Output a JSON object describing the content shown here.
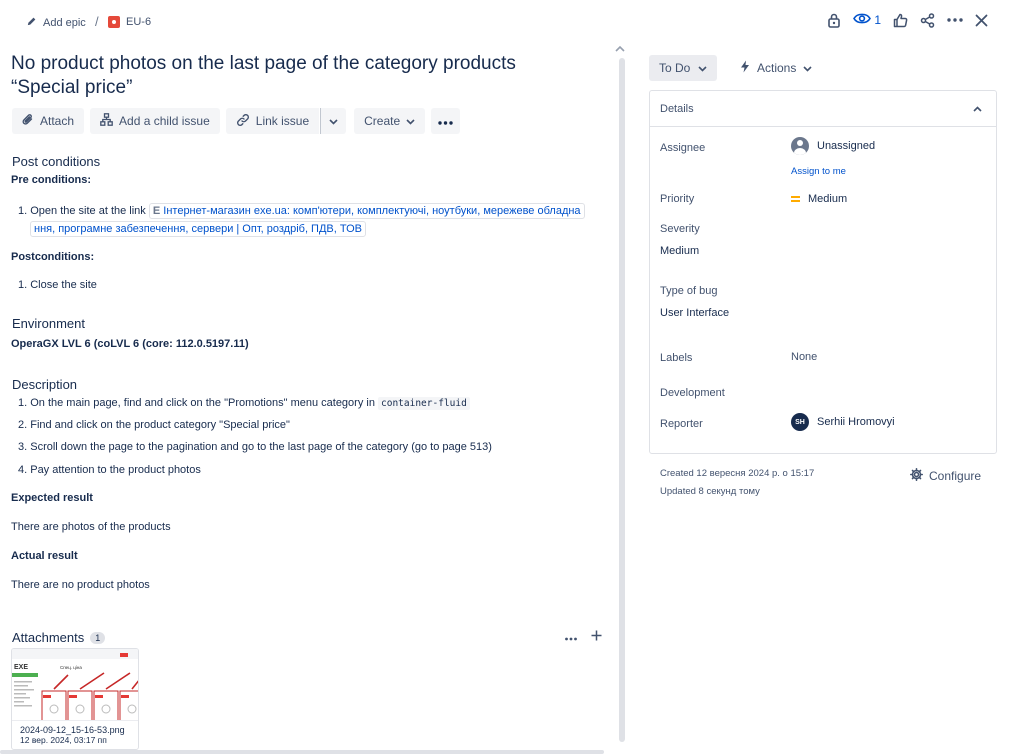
{
  "breadcrumb": {
    "add_epic": "Add epic",
    "separator": "/",
    "issue_key": "EU-6"
  },
  "header": {
    "watchers_count": "1"
  },
  "issue": {
    "title": "No product photos on the last page of the category products “Special price”"
  },
  "toolbar": {
    "attach": "Attach",
    "add_child": "Add a child issue",
    "link_issue": "Link issue",
    "create": "Create"
  },
  "post_conditions": {
    "heading": "Post conditions",
    "pre_label": "Pre conditions:",
    "pre_item_prefix": "1. Open the site at the link",
    "link_line1": "Інтернет-магазин exe.ua: комп'ютери, комплектуючі, ноутбуки, мережеве обладна",
    "link_line2": "ння, програмне забезпечення, сервери | Опт, роздріб, ПДВ, ТОВ",
    "post_label": "Postconditions:",
    "post_item": "1. Close the site"
  },
  "environment": {
    "heading": "Environment",
    "value": "OperaGX LVL 6 (coLVL 6 (core: 112.0.5197.11)"
  },
  "description": {
    "heading": "Description",
    "step1_prefix": "1. On the main page, find and click on the \"Promotions\" menu category in",
    "step1_code": "container-fluid",
    "step2": "2. Find and click on the product category \"Special price\"",
    "step3": "3. Scroll down the page to the pagination and go to the last page of the category (go to page 513)",
    "step4": "4. Pay attention to the product photos",
    "expected_label": "Expected result",
    "expected_text": "There are photos of the products",
    "actual_label": "Actual result",
    "actual_text": "There are no product photos"
  },
  "attachments": {
    "heading": "Attachments",
    "count": "1",
    "file_name": "2024-09-12_15-16-53.png",
    "file_date": "12 вер. 2024, 03:17 пп",
    "thumb_logo": "EXE",
    "thumb_title": "Спец. ціна"
  },
  "sidebar": {
    "status": "To Do",
    "actions": "Actions",
    "details_heading": "Details",
    "assignee_label": "Assignee",
    "assignee_value": "Unassigned",
    "assign_to_me": "Assign to me",
    "priority_label": "Priority",
    "priority_value": "Medium",
    "severity_label": "Severity",
    "severity_value": "Medium",
    "type_label": "Type of bug",
    "type_value": "User Interface",
    "labels_label": "Labels",
    "labels_value": "None",
    "development_label": "Development",
    "reporter_label": "Reporter",
    "reporter_initials": "SH",
    "reporter_name": "Serhii Hromovyi",
    "created": "Created 12 вересня 2024 р. о 15:17",
    "updated": "Updated 8 секунд тому",
    "configure": "Configure"
  },
  "colors": {
    "link": "#0052cc",
    "bug": "#e5493a",
    "priority_medium": "#ffab00"
  }
}
